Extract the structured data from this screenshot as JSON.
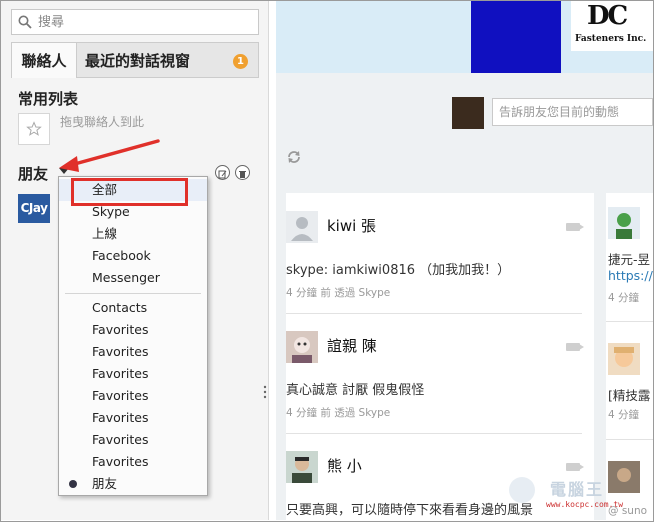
{
  "search": {
    "placeholder": "搜尋"
  },
  "tabs": [
    {
      "label": "聯絡人"
    },
    {
      "label": "最近的對話視窗",
      "badge": "1"
    }
  ],
  "favorites": {
    "title": "常用列表",
    "hint": "拖曳聯絡人到此"
  },
  "friends": {
    "title": "朋友",
    "avatar_text": "CJay"
  },
  "dropdown": {
    "items": [
      "全部",
      "Skype",
      "上線",
      "Facebook",
      "Messenger"
    ],
    "items2": [
      "Contacts",
      "Favorites",
      "Favorites",
      "Favorites",
      "Favorites",
      "Favorites",
      "Favorites",
      "Favorites"
    ],
    "selected": "朋友"
  },
  "banner": {
    "logo_mark": "DC",
    "logo_text": "Fasteners Inc."
  },
  "status": {
    "placeholder": "告訴朋友您目前的動態"
  },
  "feed": [
    {
      "name": "kiwi 張",
      "text": "skype: iamkiwi0816 （加我加我！）",
      "meta": "4 分鐘 前 透過 Skype"
    },
    {
      "name": "誼親 陳",
      "text": "真心誠意 討厭 假鬼假怪",
      "meta": "4 分鐘 前 透過 Skype"
    },
    {
      "name": "熊 小",
      "text": "只要高興，可以隨時停下來看看身邊的風景",
      "meta": ""
    }
  ],
  "side": [
    {
      "text": "捷元-昱",
      "link": "https://",
      "meta": "4 分鐘"
    },
    {
      "text": "[精技露",
      "meta": "4 分鐘"
    },
    {
      "meta": "@ suno"
    }
  ],
  "watermark": {
    "title": "電腦王",
    "url": "www.kocpc.com.tw"
  },
  "colors": {
    "accent_red": "#e0302a",
    "badge_orange": "#f0a030",
    "banner_blue": "#1010c0"
  }
}
